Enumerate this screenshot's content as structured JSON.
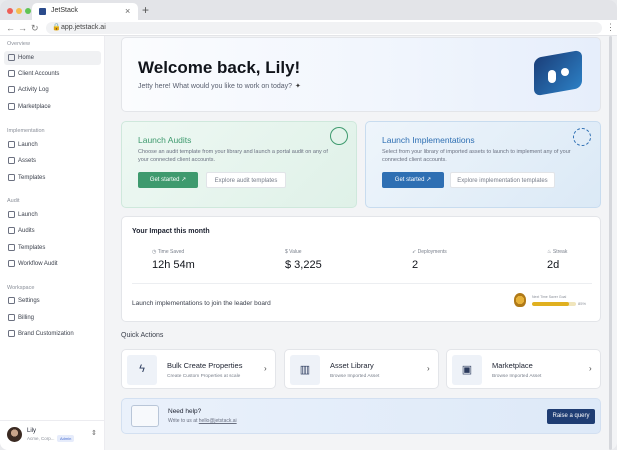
{
  "browser": {
    "tab_title": "JetStack",
    "tab_close": "×",
    "new_tab": "+",
    "url": "app.jetstack.ai",
    "back": "←",
    "forward": "→",
    "reload": "↻",
    "menu": "⋮",
    "traffic_lights": [
      "#ee5f57",
      "#f5bd4f",
      "#5fc454"
    ]
  },
  "sidebar": {
    "sections": [
      {
        "title": "Overview",
        "items": [
          {
            "label": "Home",
            "icon": "home-icon",
            "active": true
          },
          {
            "label": "Client Accounts",
            "icon": "users-icon"
          },
          {
            "label": "Activity Log",
            "icon": "activity-icon"
          },
          {
            "label": "Marketplace",
            "icon": "store-icon"
          }
        ]
      },
      {
        "title": "Implementation",
        "items": [
          {
            "label": "Launch",
            "icon": "rocket-icon"
          },
          {
            "label": "Assets",
            "icon": "database-icon"
          },
          {
            "label": "Templates",
            "icon": "document-icon"
          }
        ]
      },
      {
        "title": "Audit",
        "items": [
          {
            "label": "Launch",
            "icon": "rocket-icon"
          },
          {
            "label": "Audits",
            "icon": "search-icon"
          },
          {
            "label": "Templates",
            "icon": "document-icon"
          },
          {
            "label": "Workflow Audit",
            "icon": "workflow-icon"
          }
        ]
      },
      {
        "title": "Workspace",
        "items": [
          {
            "label": "Settings",
            "icon": "gear-icon"
          },
          {
            "label": "Billing",
            "icon": "card-icon"
          },
          {
            "label": "Brand Customization",
            "icon": "palette-icon"
          }
        ]
      }
    ],
    "user": {
      "name": "Lily",
      "org": "Acme, Corp...",
      "badge": "Admin"
    }
  },
  "hero": {
    "title": "Welcome back, Lily!",
    "subtitle": "Jetty here! What would you like to work on today?"
  },
  "launch_audits": {
    "title": "Launch Audits",
    "desc": "Choose an audit template from your library and launch a portal audit on any of your connected client accounts.",
    "primary": "Get started",
    "secondary": "Explore audit templates",
    "accent": "#3e9a6e"
  },
  "launch_implementations": {
    "title": "Launch Implementations",
    "desc": "Select from your library of imported assets to launch to implement any of your connected client accounts.",
    "primary": "Get started",
    "secondary": "Explore implementation templates",
    "accent": "#2e6fb3"
  },
  "impact": {
    "title": "Your Impact this month",
    "metrics": [
      {
        "label": "Time Saved",
        "value": "12h 54m",
        "icon": "clock-icon"
      },
      {
        "label": "Value",
        "value": "$ 3,225",
        "icon": "dollar-icon"
      },
      {
        "label": "Deployments",
        "value": "2",
        "icon": "rocket-icon"
      },
      {
        "label": "Streak",
        "value": "2d",
        "icon": "flame-icon"
      }
    ],
    "leaderboard_text": "Launch implementations to join the leader board",
    "progress_label": "Next Time Saver Goal",
    "progress_pct_text": "85%",
    "progress_value": 0.85
  },
  "quick_actions": {
    "title": "Quick Actions",
    "items": [
      {
        "name": "Bulk Create Properties",
        "sub": "Create Custom Properties at scale",
        "icon": "bolt-icon"
      },
      {
        "name": "Asset Library",
        "sub": "Browse Imported Asset",
        "icon": "library-icon"
      },
      {
        "name": "Marketplace",
        "sub": "Browse Imported Asset",
        "icon": "bag-icon"
      }
    ]
  },
  "help": {
    "title": "Need help?",
    "sub_prefix": "Write to us at ",
    "email": "hello@jetstack.ai",
    "button": "Raise a query"
  }
}
